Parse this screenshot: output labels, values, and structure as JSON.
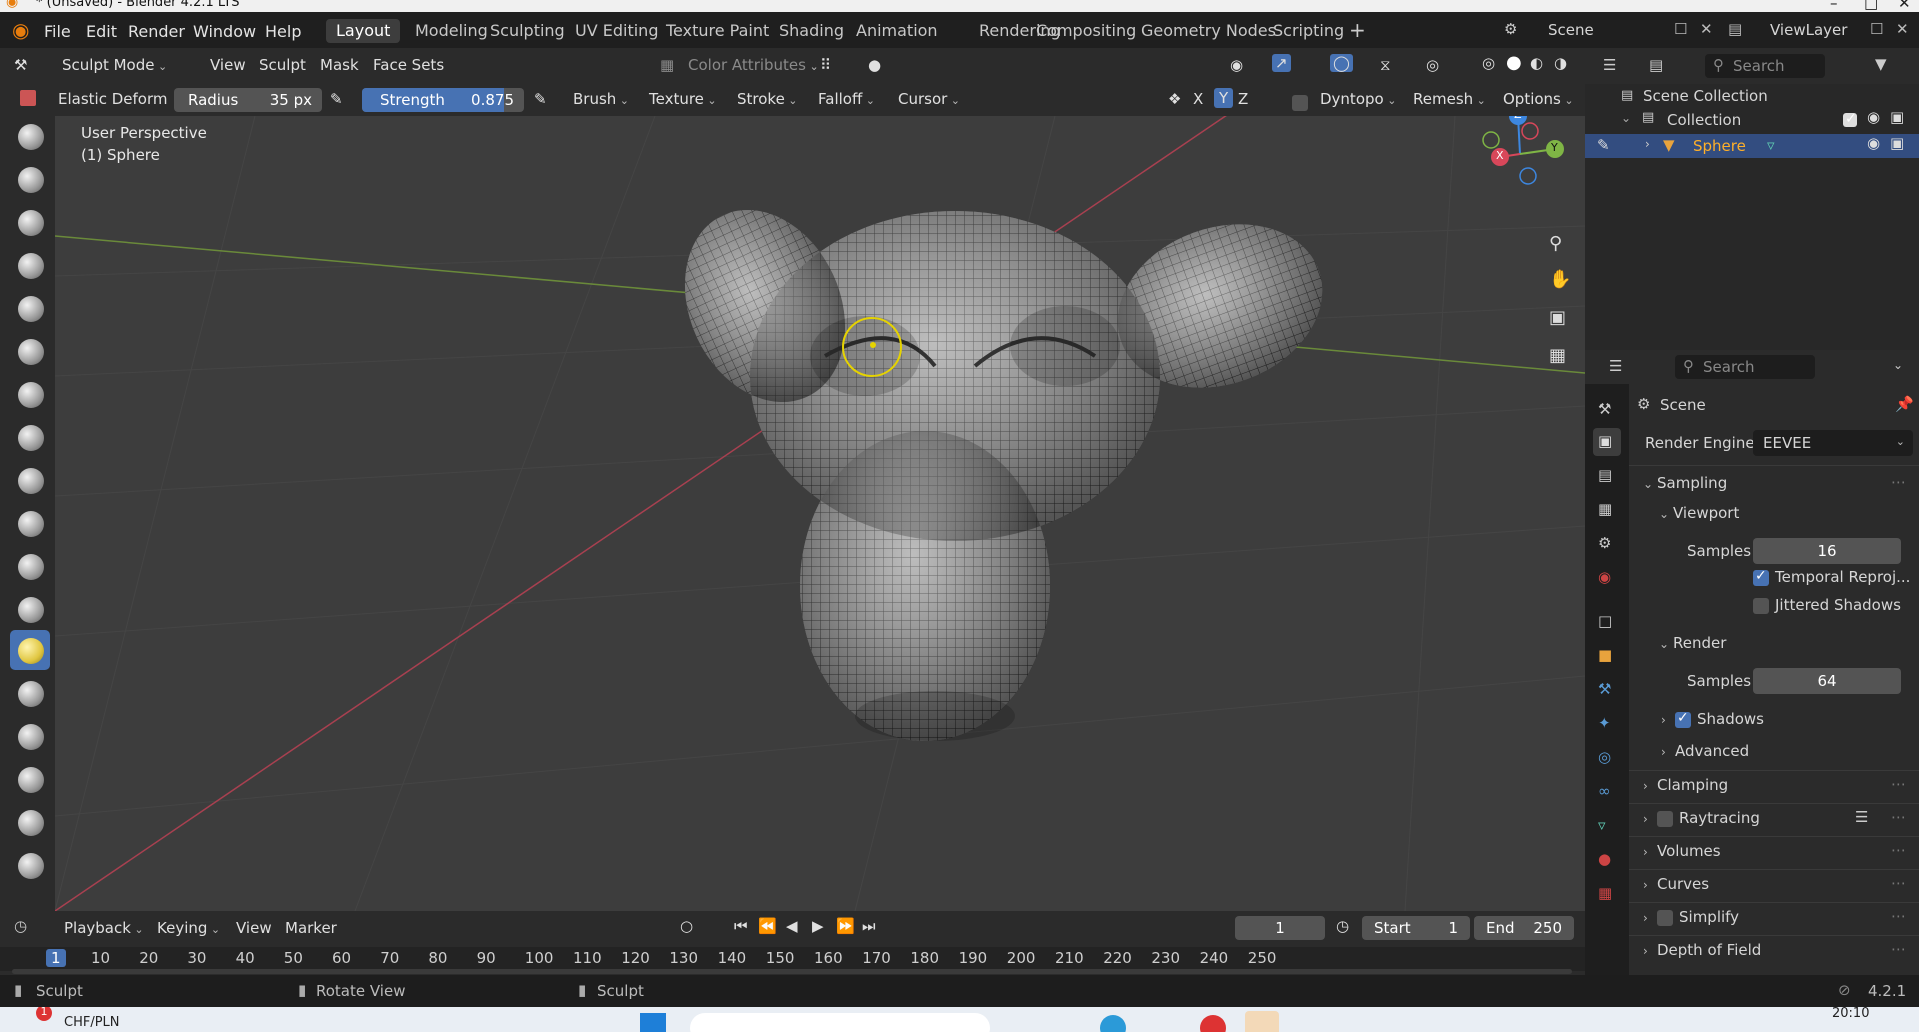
{
  "window": {
    "title": "* (Unsaved) - Blender 4.2.1 LTS"
  },
  "menu": [
    "File",
    "Edit",
    "Render",
    "Window",
    "Help"
  ],
  "workspaces": [
    "Layout",
    "Modeling",
    "Sculpting",
    "UV Editing",
    "Texture Paint",
    "Shading",
    "Animation",
    "Rendering",
    "Compositing",
    "Geometry Nodes",
    "Scripting"
  ],
  "active_workspace": "Layout",
  "scene_name": "Scene",
  "view_layer": "ViewLayer",
  "header": {
    "mode": "Sculpt Mode",
    "menus": [
      "View",
      "Sculpt",
      "Mask",
      "Face Sets"
    ],
    "color_attributes": "Color Attributes",
    "search_placeholder": "Search"
  },
  "tool_settings": {
    "brush_name": "Elastic Deform",
    "radius_label": "Radius",
    "radius_value": "35 px",
    "strength_label": "Strength",
    "strength_value": "0.875",
    "strength_fraction": 0.875,
    "menus": [
      "Brush",
      "Texture",
      "Stroke",
      "Falloff",
      "Cursor"
    ],
    "axes": [
      "X",
      "Y",
      "Z"
    ],
    "dyntopo": "Dyntopo",
    "remesh": "Remesh",
    "options": "Options"
  },
  "viewport": {
    "perspective": "User Perspective",
    "object": "(1) Sphere",
    "gizmo": {
      "z": "Z",
      "y": "Y",
      "x": "X"
    }
  },
  "outliner": {
    "root": "Scene Collection",
    "collection": "Collection",
    "object": "Sphere"
  },
  "properties": {
    "search_placeholder": "Search",
    "context": "Scene",
    "render_engine_label": "Render Engine",
    "render_engine": "EEVEE",
    "sampling": "Sampling",
    "viewport_panel": "Viewport",
    "samples_label": "Samples",
    "viewport_samples": "16",
    "temporal_reprojection": "Temporal Reproj...",
    "jittered_shadows": "Jittered Shadows",
    "render_panel": "Render",
    "render_samples": "64",
    "shadows": "Shadows",
    "advanced": "Advanced",
    "panels": [
      "Clamping",
      "Raytracing",
      "Volumes",
      "Curves",
      "Simplify",
      "Depth of Field"
    ]
  },
  "timeline": {
    "menus": [
      "Playback",
      "Keying",
      "View",
      "Marker"
    ],
    "current_frame": "1",
    "start_label": "Start",
    "start": "1",
    "end_label": "End",
    "end": "250",
    "ticks": [
      "1",
      "10",
      "20",
      "30",
      "40",
      "50",
      "60",
      "70",
      "80",
      "90",
      "100",
      "110",
      "120",
      "130",
      "140",
      "150",
      "160",
      "170",
      "180",
      "190",
      "200",
      "210",
      "220",
      "230",
      "240",
      "250"
    ]
  },
  "status": {
    "left": "Sculpt",
    "middle": "Rotate View",
    "right": "Sculpt",
    "version": "4.2.1"
  },
  "taskbar": {
    "weather": "CHF/PLN",
    "time": "20:10"
  },
  "colors": {
    "accent": "#4772b3",
    "strength_field": "#4772b3",
    "brush_circle": "#e6d300",
    "axis_x": "#d8475a",
    "axis_y": "#7fb545",
    "axis_z": "#3d87e0"
  }
}
